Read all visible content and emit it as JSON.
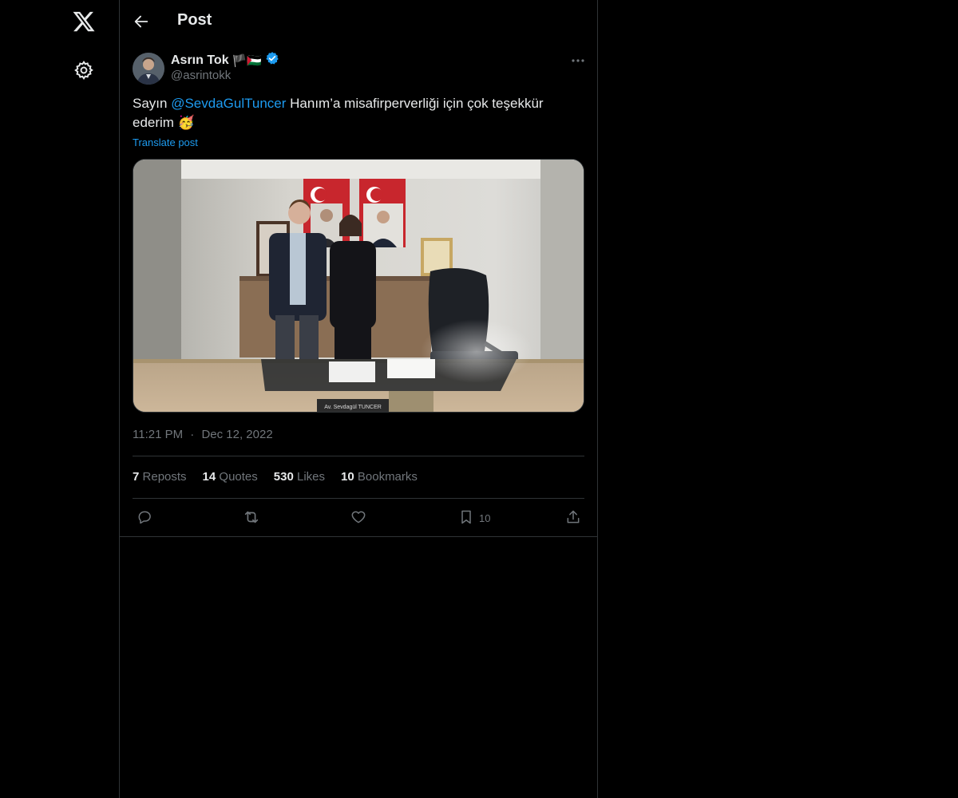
{
  "nav": {
    "logo_icon": "x-logo-icon",
    "settings_icon": "gear-icon"
  },
  "header": {
    "title": "Post",
    "back_icon": "arrow-left-icon"
  },
  "author": {
    "name": "Asrın Tok",
    "name_suffix": "🏴🇵🇸",
    "verified_icon": "verified-badge-icon",
    "handle": "@asrintokk"
  },
  "post": {
    "text_before": "Sayın ",
    "mention": "@SevdaGulTuncer",
    "text_after": " Hanım’a misafirperverliği için çok teşekkür ederim 🥳",
    "translate": "Translate post",
    "time": "11:21 PM",
    "separator": "·",
    "date": "Dec 12, 2022",
    "nameplate": "Av. Sevdagül TUNCER"
  },
  "stats": {
    "reposts_count": "7",
    "reposts_label": "Reposts",
    "quotes_count": "14",
    "quotes_label": "Quotes",
    "likes_count": "530",
    "likes_label": "Likes",
    "bookmarks_count": "10",
    "bookmarks_label": "Bookmarks"
  },
  "actions": {
    "reply_icon": "reply-icon",
    "repost_icon": "repost-icon",
    "like_icon": "heart-icon",
    "bookmark_icon": "bookmark-icon",
    "bookmark_count": "10",
    "share_icon": "share-icon"
  },
  "colors": {
    "background": "#000000",
    "text": "#e7e9ea",
    "muted": "#71767b",
    "accent": "#1d9bf0",
    "border": "#2f3336"
  }
}
